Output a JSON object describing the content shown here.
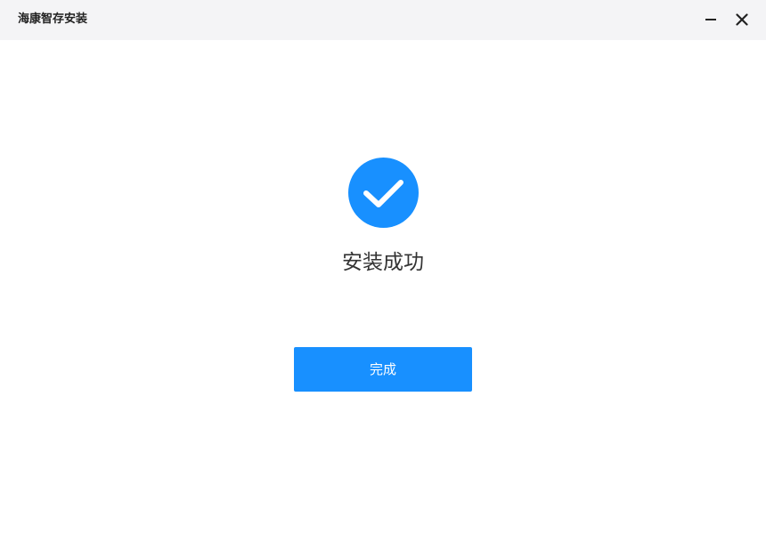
{
  "window": {
    "title": "海康智存安装",
    "minimize_icon": "minimize-icon",
    "close_icon": "close-icon"
  },
  "status": {
    "icon": "check-circle-icon",
    "icon_color": "#1890ff",
    "message": "安装成功"
  },
  "actions": {
    "finish_label": "完成",
    "finish_color": "#1890ff"
  }
}
